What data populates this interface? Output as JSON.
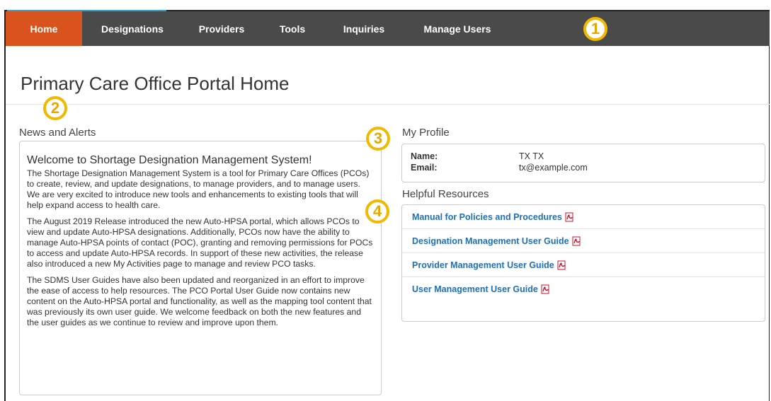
{
  "nav": {
    "items": [
      {
        "label": "Home",
        "active": true
      },
      {
        "label": "Designations",
        "active": false
      },
      {
        "label": "Providers",
        "active": false
      },
      {
        "label": "Tools",
        "active": false
      },
      {
        "label": "Inquiries",
        "active": false
      },
      {
        "label": "Manage Users",
        "active": false
      }
    ],
    "active_color": "#d9531e",
    "bar_color": "#4a4a4a"
  },
  "callouts": [
    "1",
    "2",
    "3",
    "4"
  ],
  "page": {
    "title": "Primary Care Office Portal Home"
  },
  "news": {
    "section_label": "News and Alerts",
    "heading": "Welcome to Shortage Designation Management System!",
    "paragraphs": [
      "The Shortage Designation Management System is a tool for Primary Care Offices (PCOs) to create, review, and update designations, to manage providers, and to manage users. We are very excited to introduce new tools and enhancements to existing tools that will help expand access to health care.",
      "The August 2019 Release introduced the new Auto-HPSA portal, which allows PCOs to view and update Auto-HPSA designations. Additionally, PCOs now have the ability to manage Auto-HPSA points of contact (POC), granting and removing permissions for POCs to access and update Auto-HPSA records. In support of these new activities, the release also introduced a new My Activities page to manage and review PCO tasks.",
      "The SDMS User Guides have also been updated and reorganized in an effort to improve the ease of access to help resources. The PCO Portal User Guide now contains new content on the Auto-HPSA portal and functionality, as well as the mapping tool content that was previously its own user guide. We welcome feedback on both the new features and the user guides as we continue to review and improve upon them."
    ]
  },
  "profile": {
    "section_label": "My Profile",
    "name_label": "Name:",
    "name_value": "TX TX",
    "email_label": "Email:",
    "email_value": "tx@example.com"
  },
  "resources": {
    "section_label": "Helpful Resources",
    "items": [
      {
        "label": "Manual for Policies and Procedures",
        "icon": "pdf-icon"
      },
      {
        "label": "Designation Management User Guide",
        "icon": "pdf-icon"
      },
      {
        "label": "Provider Management User Guide",
        "icon": "pdf-icon"
      },
      {
        "label": "User Management User Guide",
        "icon": "pdf-icon"
      }
    ]
  }
}
